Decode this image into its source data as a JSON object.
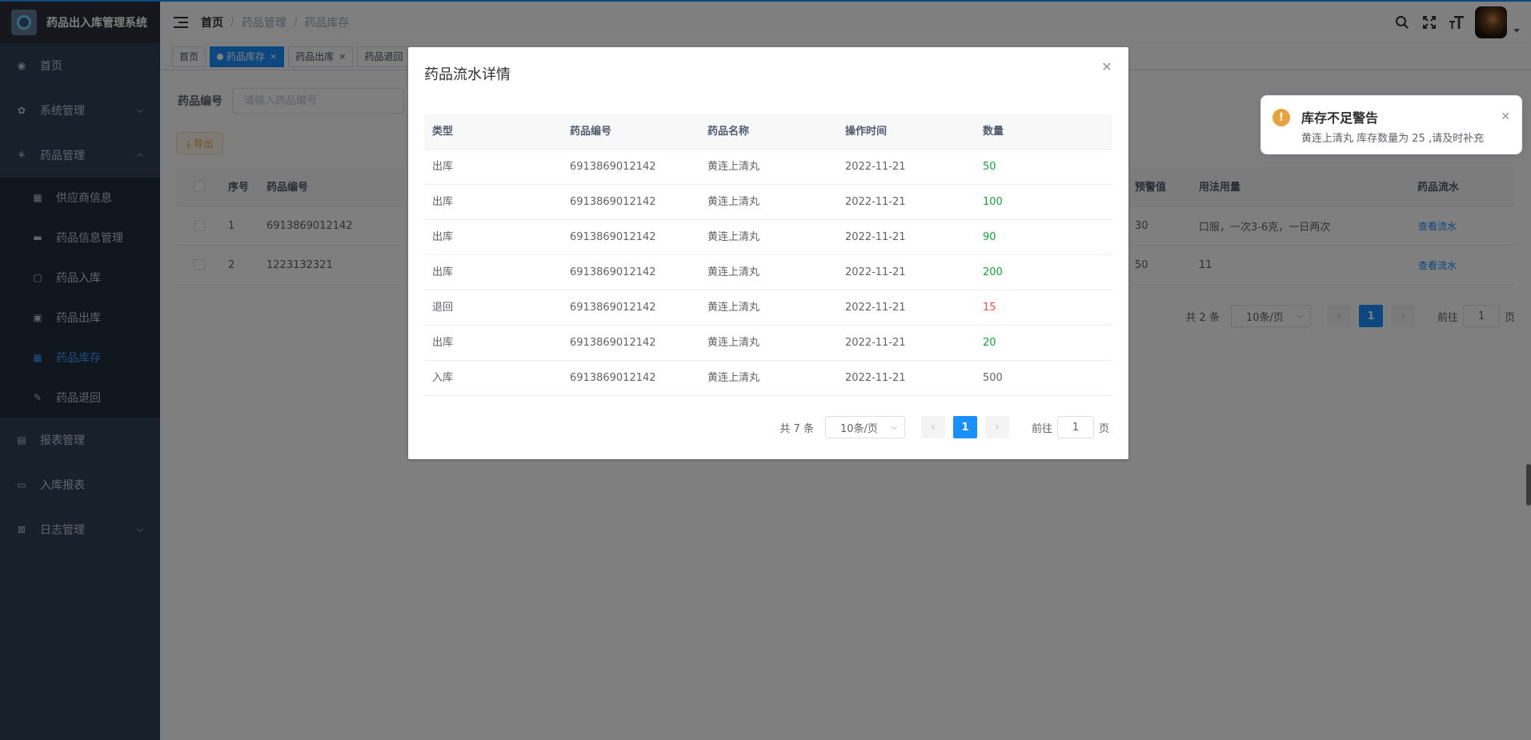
{
  "app": {
    "title": "药品出入库管理系统"
  },
  "sidebar": {
    "items": [
      {
        "label": "首页",
        "icon": "dashboard-icon"
      },
      {
        "label": "系统管理",
        "icon": "gear-icon"
      },
      {
        "label": "药品管理",
        "icon": "pill-icon"
      }
    ],
    "sub_items": [
      {
        "label": "供应商信息",
        "icon": "grid-icon"
      },
      {
        "label": "药品信息管理",
        "icon": "message-icon"
      },
      {
        "label": "药品入库",
        "icon": "book-icon"
      },
      {
        "label": "药品出库",
        "icon": "book-open-icon"
      },
      {
        "label": "药品库存",
        "icon": "table-icon",
        "active": true
      },
      {
        "label": "药品退回",
        "icon": "edit-icon"
      }
    ],
    "bottom_items": [
      {
        "label": "报表管理",
        "icon": "chart-icon"
      },
      {
        "label": "入库报表",
        "icon": "monitor-icon"
      },
      {
        "label": "日志管理",
        "icon": "log-icon"
      }
    ]
  },
  "navbar": {
    "breadcrumb": [
      "首页",
      "药品管理",
      "药品库存"
    ],
    "icons": [
      "search-icon",
      "fullscreen-icon",
      "font-size-icon"
    ]
  },
  "tags": [
    {
      "label": "首页"
    },
    {
      "label": "药品库存",
      "active": true
    },
    {
      "label": "药品出库"
    },
    {
      "label": "药品退回"
    }
  ],
  "filter": {
    "label": "药品编号",
    "placeholder": "请输入药品编号"
  },
  "export_label": "⤓ 导出",
  "bg_table": {
    "headers": {
      "seq": "序号",
      "code": "药品编号",
      "warn": "预警值",
      "usage": "用法用量",
      "flow": "药品流水"
    },
    "rows": [
      {
        "seq": "1",
        "code": "6913869012142",
        "warn": "30",
        "usage": "口服，一次3-6克，一日两次",
        "flow": "查看流水"
      },
      {
        "seq": "2",
        "code": "1223132321",
        "warn": "50",
        "usage": "11",
        "flow": "查看流水"
      }
    ],
    "pager": {
      "total": "共 2 条",
      "size": "10条/页",
      "page": "1",
      "goto": "前往",
      "goto_value": "1",
      "unit": "页"
    }
  },
  "dialog": {
    "title": "药品流水详情",
    "headers": [
      "类型",
      "药品编号",
      "药品名称",
      "操作时间",
      "数量"
    ],
    "rows": [
      {
        "type": "出库",
        "code": "6913869012142",
        "name": "黄连上清丸",
        "time": "2022-11-21",
        "qty": "50"
      },
      {
        "type": "出库",
        "code": "6913869012142",
        "name": "黄连上清丸",
        "time": "2022-11-21",
        "qty": "100"
      },
      {
        "type": "出库",
        "code": "6913869012142",
        "name": "黄连上清丸",
        "time": "2022-11-21",
        "qty": "90"
      },
      {
        "type": "出库",
        "code": "6913869012142",
        "name": "黄连上清丸",
        "time": "2022-11-21",
        "qty": "200"
      },
      {
        "type": "退回",
        "code": "6913869012142",
        "name": "黄连上清丸",
        "time": "2022-11-21",
        "qty": "15"
      },
      {
        "type": "出库",
        "code": "6913869012142",
        "name": "黄连上清丸",
        "time": "2022-11-21",
        "qty": "20"
      },
      {
        "type": "入库",
        "code": "6913869012142",
        "name": "黄连上清丸",
        "time": "2022-11-21",
        "qty": "500"
      }
    ],
    "pager": {
      "total": "共 7 条",
      "size": "10条/页",
      "page": "1",
      "goto": "前往",
      "goto_value": "1",
      "unit": "页"
    }
  },
  "notification": {
    "title": "库存不足警告",
    "message": "黄连上清丸 库存数量为 25 ,请及时补充",
    "icon": "warning-icon"
  },
  "colors": {
    "accent": "#1890ff",
    "out": "#11a83b",
    "return": "#ff4949",
    "warning": "#e6a23c"
  }
}
